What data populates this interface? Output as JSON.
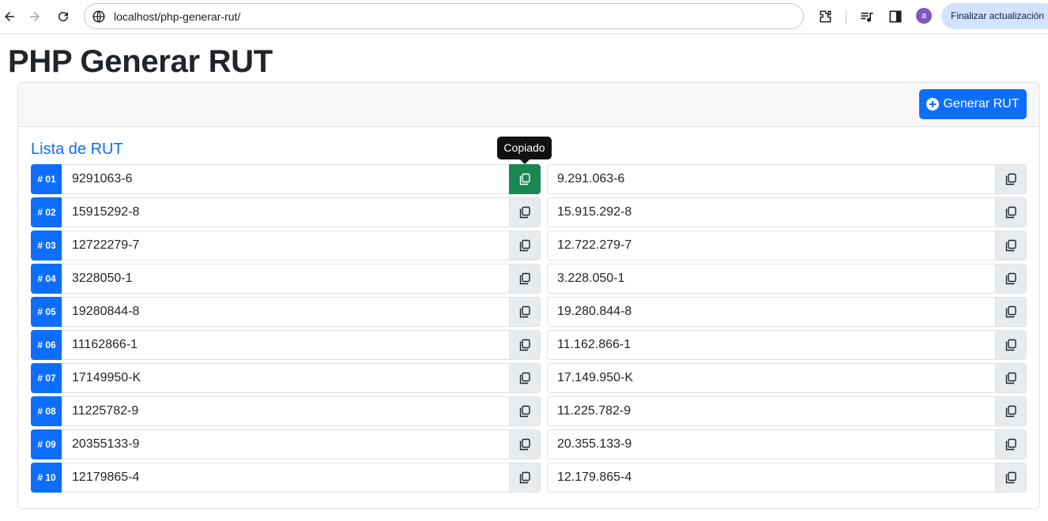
{
  "browser": {
    "url": "localhost/php-generar-rut/",
    "update_button": "Finalizar actualización",
    "avatar_initial": "a"
  },
  "page": {
    "title": "PHP Generar RUT",
    "generate_button": "Generar RUT",
    "list_title": "Lista de RUT",
    "tooltip": "Copiado"
  },
  "ruts": [
    {
      "num": "# 01",
      "plain": "9291063-6",
      "formatted": "9.291.063-6"
    },
    {
      "num": "# 02",
      "plain": "15915292-8",
      "formatted": "15.915.292-8"
    },
    {
      "num": "# 03",
      "plain": "12722279-7",
      "formatted": "12.722.279-7"
    },
    {
      "num": "# 04",
      "plain": "3228050-1",
      "formatted": "3.228.050-1"
    },
    {
      "num": "# 05",
      "plain": "19280844-8",
      "formatted": "19.280.844-8"
    },
    {
      "num": "# 06",
      "plain": "11162866-1",
      "formatted": "11.162.866-1"
    },
    {
      "num": "# 07",
      "plain": "17149950-K",
      "formatted": "17.149.950-K"
    },
    {
      "num": "# 08",
      "plain": "11225782-9",
      "formatted": "11.225.782-9"
    },
    {
      "num": "# 09",
      "plain": "20355133-9",
      "formatted": "20.355.133-9"
    },
    {
      "num": "# 10",
      "plain": "12179865-4",
      "formatted": "12.179.865-4"
    }
  ],
  "colors": {
    "primary": "#0d6efd",
    "success": "#198754",
    "copy_bg": "#e9ecef"
  }
}
